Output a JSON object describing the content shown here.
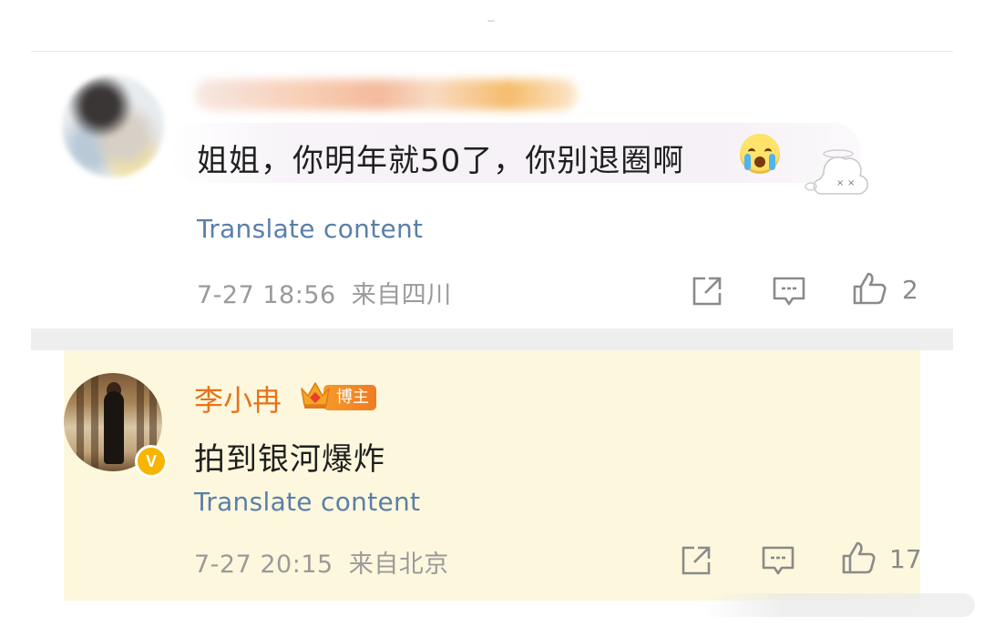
{
  "comment1": {
    "text": "姐姐，你明年就50了，你别退圈啊",
    "emoji": "crying-face",
    "sticker": "ghost-sticker",
    "translate_label": "Translate content",
    "timestamp": "7-27 18:56",
    "location": "来自四川",
    "like_count": "2"
  },
  "comment2": {
    "username": "李小冉",
    "badge": "博主",
    "text": "拍到银河爆炸",
    "translate_label": "Translate content",
    "timestamp": "7-27 20:15",
    "location": "来自北京",
    "like_count": "17",
    "verified_badge": "V"
  },
  "icons": {
    "share": "share-icon",
    "comment": "comment-icon",
    "like": "thumbs-up-icon"
  },
  "colors": {
    "username": "#e8721c",
    "link": "#5a7fa8",
    "meta": "#9a9a9a",
    "highlight_background": "#fdf8dd",
    "verified": "#f7b500"
  }
}
